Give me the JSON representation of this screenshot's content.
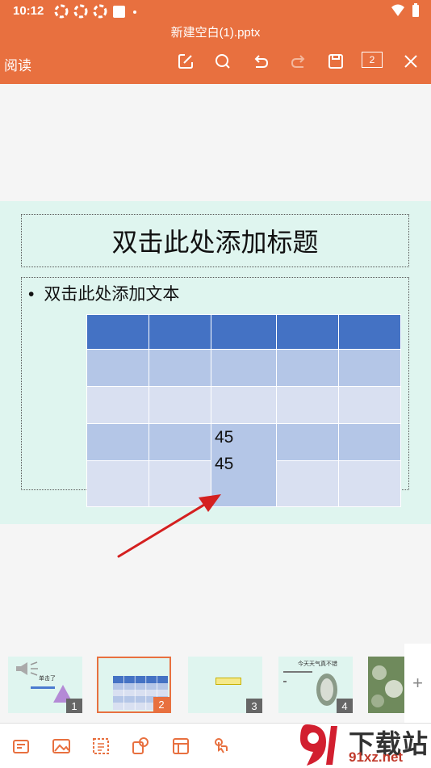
{
  "status": {
    "time": "10:12"
  },
  "header": {
    "file_title": "新建空白(1).pptx",
    "mode": "阅读",
    "page_count": "2"
  },
  "slide": {
    "title": "双击此处添加标题",
    "bullet": "双击此处添加文本",
    "cell_values": [
      "45",
      "45"
    ]
  },
  "thumbnails": [
    {
      "num": "1"
    },
    {
      "num": "2"
    },
    {
      "num": "3"
    },
    {
      "num": "4"
    }
  ],
  "thumb_texts": {
    "t1": "单击了",
    "t4_title": "今天天气真不错"
  },
  "add_label": "+",
  "watermark": {
    "brand": "下载站",
    "url": "91xz.net"
  },
  "colors": {
    "accent": "#e8703f",
    "slide_bg": "#dff5ef",
    "table_header": "#4472c4",
    "table_row_dark": "#b4c6e7",
    "table_row_light": "#d9e0f1",
    "arrow": "#d42020"
  }
}
